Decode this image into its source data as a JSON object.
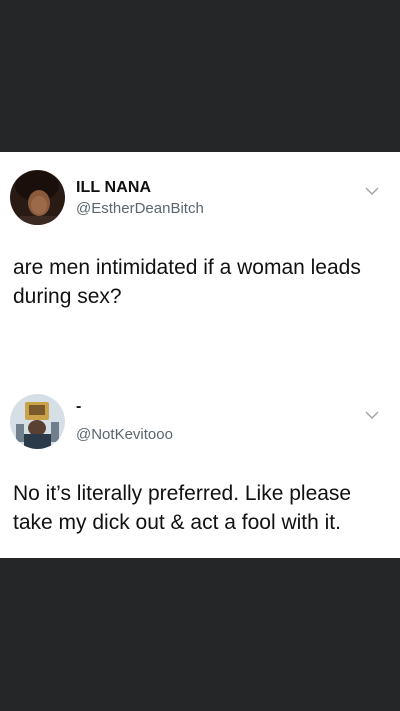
{
  "tweets": [
    {
      "name": "ILL NANA",
      "handle": "@EstherDeanBitch",
      "text": "are men intimidated if a woman leads during sex?"
    },
    {
      "name": "-",
      "handle": "@NotKevitooo",
      "text": "No it’s literally preferred. Like please take my dick out & act a fool with it."
    }
  ],
  "icons": {
    "more": "chevron-down-icon"
  },
  "colors": {
    "background": "#252627",
    "card": "#ffffff",
    "handle": "#5b6670",
    "text": "#111111"
  }
}
